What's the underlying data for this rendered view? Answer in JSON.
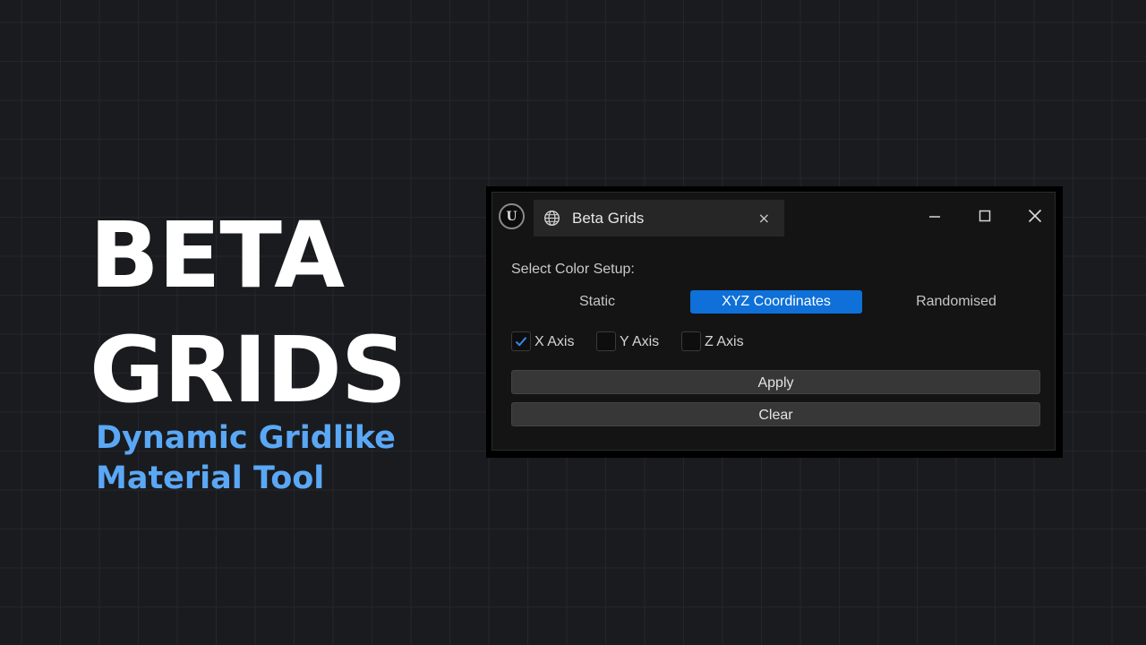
{
  "hero": {
    "title_lines": [
      "BETA",
      "GRIDS"
    ],
    "subtitle_lines": [
      "Dynamic Gridlike",
      "Material Tool"
    ]
  },
  "window": {
    "logo_icon": "unreal-engine-logo-icon",
    "logo_glyph": "U",
    "tab": {
      "icon": "globe-grid-icon",
      "label": "Beta Grids",
      "close_glyph": "×"
    },
    "controls": {
      "minimize_icon": "minimize-icon",
      "maximize_icon": "maximize-icon",
      "close_icon": "close-icon"
    }
  },
  "panel": {
    "color_setup_label": "Select Color Setup:",
    "modes": [
      {
        "label": "Static",
        "selected": false
      },
      {
        "label": "XYZ Coordinates",
        "selected": true
      },
      {
        "label": "Randomised",
        "selected": false
      }
    ],
    "axes": [
      {
        "label": "X Axis",
        "checked": true
      },
      {
        "label": "Y Axis",
        "checked": false
      },
      {
        "label": "Z Axis",
        "checked": false
      }
    ],
    "apply_label": "Apply",
    "clear_label": "Clear"
  },
  "colors": {
    "accent": "#0e70d8",
    "subtitle": "#5aa8f5",
    "background": "#1a1b1f",
    "checkmark": "#2f8ae8"
  }
}
